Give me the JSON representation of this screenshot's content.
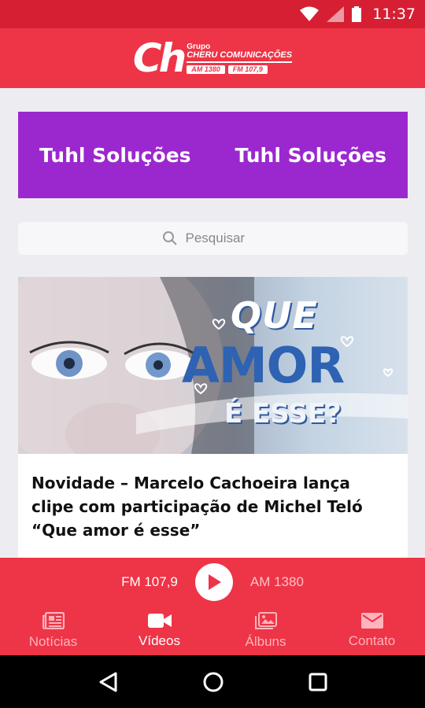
{
  "status_bar": {
    "time": "11:37"
  },
  "header": {
    "logo_mark": "Ch",
    "logo_grupo": "Grupo",
    "logo_name": "CHERU COMUNICAÇÕES",
    "logo_am": "AM 1380",
    "logo_fm": "FM 107,9"
  },
  "banner": {
    "text_left": "Tuhl Soluções",
    "text_right": "Tuhl Soluções",
    "background": "#9b28cf"
  },
  "search": {
    "placeholder": "Pesquisar"
  },
  "news": {
    "image_overlay": {
      "line1": "QUE",
      "line2": "AMOR",
      "line3": "É ESSE?"
    },
    "title": "Novidade – Marcelo Cachoeira lança clipe com participação de Michel Teló “Que amor é esse”"
  },
  "player": {
    "fm_label": "FM 107,9",
    "am_label": "AM 1380"
  },
  "bottom_nav": {
    "items": [
      {
        "label": "Notícias",
        "icon": "newspaper-icon",
        "active": false
      },
      {
        "label": "Vídeos",
        "icon": "video-camera-icon",
        "active": true
      },
      {
        "label": "Álbuns",
        "icon": "photo-album-icon",
        "active": false
      },
      {
        "label": "Contato",
        "icon": "mail-icon",
        "active": false
      }
    ]
  },
  "colors": {
    "brand_red": "#ee3447",
    "status_red": "#d61f33",
    "banner_purple": "#9b28cf"
  }
}
